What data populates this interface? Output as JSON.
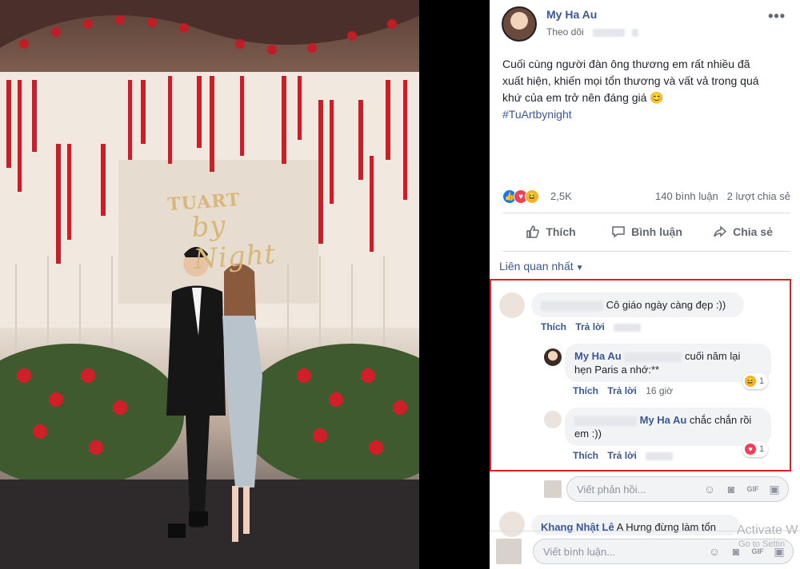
{
  "post": {
    "author": "My Ha Au",
    "follow_label": "Theo dõi",
    "text_line1": "Cuối cùng người đàn ông thương em rất nhiều đã",
    "text_line2": "xuất hiện, khiến mọi tổn thương và vất vả trong quá",
    "text_line3": "khứ của em trở nên đáng giá 😊",
    "hashtag": "#TuArtbynight",
    "reaction_count": "2,5K",
    "comment_count": "140 bình luận",
    "share_count": "2 lượt chia sẻ"
  },
  "photo": {
    "sign_title": "TUART",
    "sign_sub": "by Night"
  },
  "actions": {
    "like": "Thích",
    "comment": "Bình luận",
    "share": "Chia sẻ"
  },
  "sort": {
    "label": "Liên quan nhất"
  },
  "comments": [
    {
      "text": "Cô giáo ngày càng đẹp :))",
      "like": "Thích",
      "reply": "Trả lời"
    }
  ],
  "replies": [
    {
      "author": "My Ha Au",
      "text_a": "cuối năm lại",
      "text_b": "hẹn Paris a nhớ:**",
      "like": "Thích",
      "reply": "Trả lời",
      "time": "16 giờ",
      "reaction_count": "1"
    },
    {
      "mention": "My Ha Au",
      "text_a": "chắc chắn rồi",
      "text_b": "em :))",
      "like": "Thích",
      "reply": "Trả lời",
      "reaction_count": "1"
    }
  ],
  "reply_box": {
    "placeholder": "Viết phản hồi..."
  },
  "next_comment": {
    "author": "Khang Nhật Lê",
    "text": "A Hưng đừng làm tổn"
  },
  "comment_box": {
    "placeholder": "Viết bình luận..."
  },
  "watermark": {
    "line1": "Activate W",
    "line2": "Go to Settin"
  },
  "colors": {
    "link": "#385898",
    "highlight": "#e02020",
    "like_blue": "#1877f2",
    "love_red": "#f33e58"
  }
}
